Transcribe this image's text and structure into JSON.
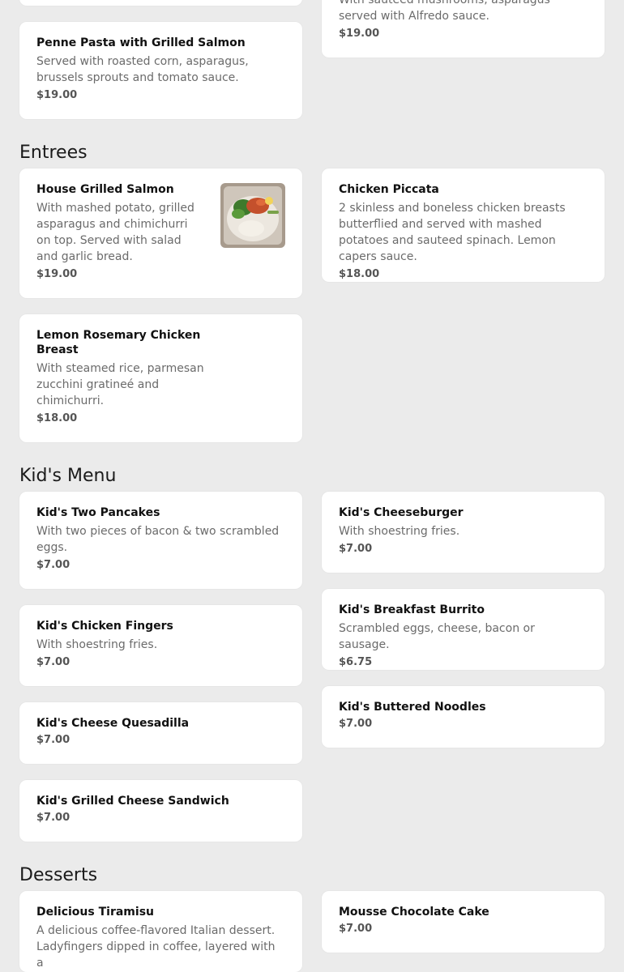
{
  "sections": {
    "entrees": "Entrees",
    "kids": "Kid's Menu",
    "desserts": "Desserts"
  },
  "pasta": {
    "top_right": {
      "desc": "With sauteed mushrooms, asparagus served with Alfredo sauce.",
      "price": "$19.00"
    },
    "penne_salmon": {
      "name": "Penne Pasta with Grilled Salmon",
      "desc": "Served with roasted corn, asparagus, brussels sprouts and tomato sauce.",
      "price": "$19.00"
    }
  },
  "entrees": {
    "house_salmon": {
      "name": "House Grilled Salmon",
      "desc": "With mashed potato, grilled asparagus and chimichurri on top. Served with salad and garlic bread.",
      "price": "$19.00"
    },
    "chicken_piccata": {
      "name": "Chicken Piccata",
      "desc": "2 skinless and boneless chicken breasts butterflied and served with mashed potatoes and sauteed spinach. Lemon capers sauce.",
      "price": "$18.00"
    },
    "lemon_chicken": {
      "name": "Lemon Rosemary Chicken Breast",
      "desc": "With steamed rice, parmesan zucchini gratineé and chimichurri.",
      "price": "$18.00"
    }
  },
  "kids": {
    "pancakes": {
      "name": "Kid's Two Pancakes",
      "desc": "With two pieces of bacon & two scrambled eggs.",
      "price": "$7.00"
    },
    "cheeseburger": {
      "name": "Kid's Cheeseburger",
      "desc": "With shoestring fries.",
      "price": "$7.00"
    },
    "chicken_fingers": {
      "name": "Kid's Chicken Fingers",
      "desc": "With shoestring fries.",
      "price": "$7.00"
    },
    "burrito": {
      "name": "Kid's Breakfast Burrito",
      "desc": "Scrambled eggs, cheese, bacon or sausage.",
      "price": "$6.75"
    },
    "quesadilla": {
      "name": "Kid's Cheese Quesadilla",
      "price": "$7.00"
    },
    "noodles": {
      "name": "Kid's Buttered Noodles",
      "price": "$7.00"
    },
    "grilled_cheese": {
      "name": "Kid's Grilled Cheese Sandwich",
      "price": "$7.00"
    }
  },
  "desserts": {
    "tiramisu": {
      "name": "Delicious Tiramisu",
      "desc": "A delicious coffee-flavored Italian dessert. Ladyfingers dipped in coffee, layered with a"
    },
    "mousse_cake": {
      "name": "Mousse Chocolate Cake",
      "price": "$7.00"
    }
  }
}
